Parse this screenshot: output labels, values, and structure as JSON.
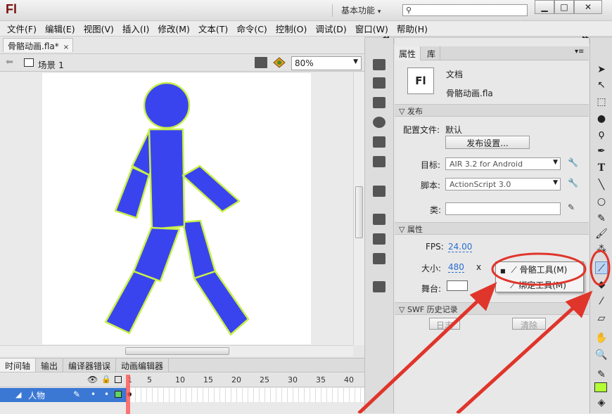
{
  "window": {
    "logo": "Fl",
    "workspace": "基本功能",
    "controls": [
      "▁",
      "□",
      "✕"
    ]
  },
  "menu": [
    "文件(F)",
    "编辑(E)",
    "视图(V)",
    "插入(I)",
    "修改(M)",
    "文本(T)",
    "命令(C)",
    "控制(O)",
    "调试(D)",
    "窗口(W)",
    "帮助(H)"
  ],
  "doc_tab": {
    "label": "骨骼动画.fla*",
    "close": "×"
  },
  "scene": {
    "label": "场景 1",
    "zoom": "80%"
  },
  "timeline": {
    "tabs": [
      "时间轴",
      "输出",
      "编译器错误",
      "动画编辑器"
    ],
    "frames": [
      "1",
      "5",
      "10",
      "15",
      "20",
      "25",
      "30",
      "35",
      "40"
    ],
    "layer": "人物"
  },
  "panel": {
    "tabs": [
      "属性",
      "库"
    ],
    "doc_type": "文档",
    "doc_icon": "Fl",
    "filename": "骨骼动画.fla",
    "publish_section": "发布",
    "profile_label": "配置文件:",
    "profile_value": "默认",
    "publish_settings_btn": "发布设置...",
    "target_label": "目标:",
    "target_value": "AIR 3.2 for Android",
    "script_label": "脚本:",
    "script_value": "ActionScript 3.0",
    "class_label": "类:",
    "class_value": "",
    "properties_section": "属性",
    "fps_label": "FPS:",
    "fps_value": "24.00",
    "size_label": "大小:",
    "size_width": "480",
    "size_x": "x",
    "stage_label": "舞台:",
    "history_section": "SWF 历史记录",
    "log_btn": "日志",
    "clear_btn": "清除"
  },
  "popup": {
    "items": [
      "骨骼工具(M)",
      "绑定工具(M)"
    ]
  },
  "colors": {
    "figure_fill": "#3a44ee",
    "figure_stroke": "#c8f04a",
    "highlight": "#e0352b",
    "stroke_swatch": "#b3ff33"
  }
}
